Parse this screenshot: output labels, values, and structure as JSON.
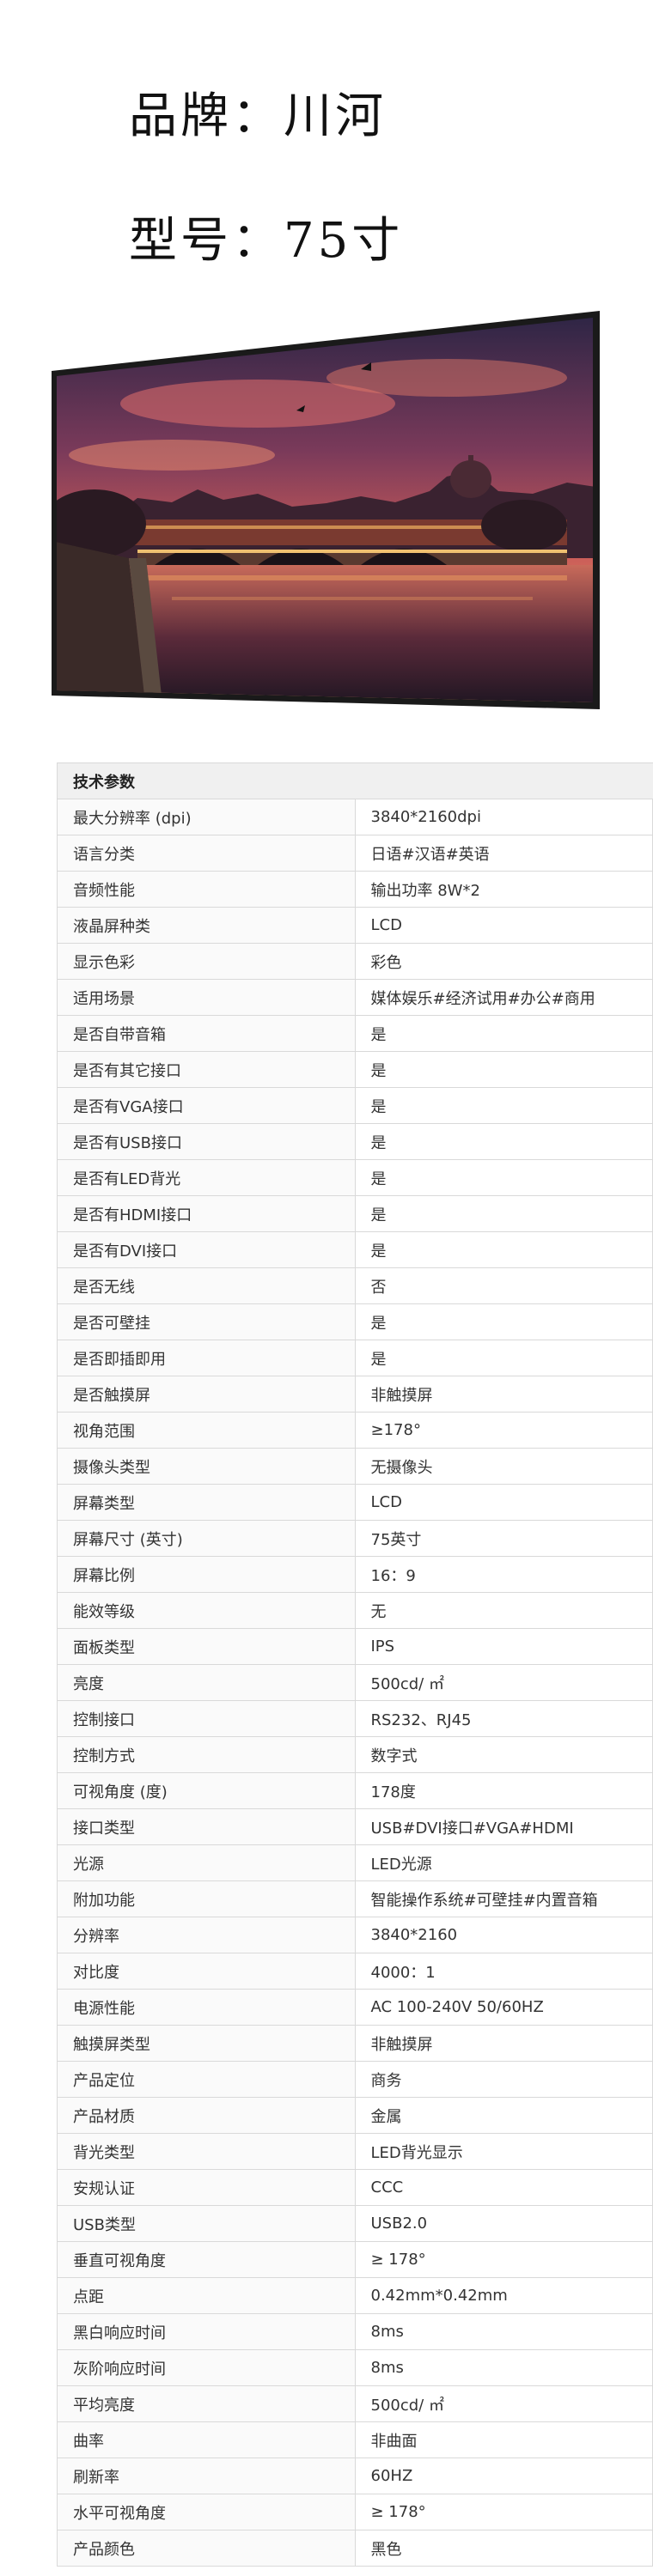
{
  "header": {
    "brand": "品牌：川河",
    "model": "型号：75寸"
  },
  "spec_table": {
    "heading": "技术参数",
    "rows": [
      {
        "k": "最大分辨率 (dpi)",
        "v": "3840*2160dpi"
      },
      {
        "k": "语言分类",
        "v": "日语#汉语#英语"
      },
      {
        "k": "音频性能",
        "v": "输出功率 8W*2"
      },
      {
        "k": "液晶屏种类",
        "v": "LCD"
      },
      {
        "k": "显示色彩",
        "v": "彩色"
      },
      {
        "k": "适用场景",
        "v": "媒体娱乐#经济试用#办公#商用"
      },
      {
        "k": "是否自带音箱",
        "v": "是"
      },
      {
        "k": "是否有其它接口",
        "v": "是"
      },
      {
        "k": "是否有VGA接口",
        "v": "是"
      },
      {
        "k": "是否有USB接口",
        "v": "是"
      },
      {
        "k": "是否有LED背光",
        "v": "是"
      },
      {
        "k": "是否有HDMI接口",
        "v": "是"
      },
      {
        "k": "是否有DVI接口",
        "v": "是"
      },
      {
        "k": "是否无线",
        "v": "否"
      },
      {
        "k": "是否可壁挂",
        "v": "是"
      },
      {
        "k": "是否即插即用",
        "v": "是"
      },
      {
        "k": "是否触摸屏",
        "v": "非触摸屏"
      },
      {
        "k": "视角范围",
        "v": "≥178°"
      },
      {
        "k": "摄像头类型",
        "v": "无摄像头"
      },
      {
        "k": "屏幕类型",
        "v": "LCD"
      },
      {
        "k": "屏幕尺寸 (英寸)",
        "v": "75英寸"
      },
      {
        "k": "屏幕比例",
        "v": "16：9"
      },
      {
        "k": "能效等级",
        "v": "无"
      },
      {
        "k": "面板类型",
        "v": "IPS"
      },
      {
        "k": "亮度",
        "v": "500cd/ ㎡"
      },
      {
        "k": "控制接口",
        "v": "RS232、RJ45"
      },
      {
        "k": "控制方式",
        "v": "数字式"
      },
      {
        "k": "可视角度 (度)",
        "v": "178度"
      },
      {
        "k": "接口类型",
        "v": "USB#DVI接口#VGA#HDMI"
      },
      {
        "k": "光源",
        "v": "LED光源"
      },
      {
        "k": "附加功能",
        "v": "智能操作系统#可壁挂#内置音箱"
      },
      {
        "k": "分辨率",
        "v": "3840*2160"
      },
      {
        "k": "对比度",
        "v": "4000：1"
      },
      {
        "k": "电源性能",
        "v": "AC 100-240V 50/60HZ"
      },
      {
        "k": "触摸屏类型",
        "v": "非触摸屏"
      },
      {
        "k": "产品定位",
        "v": "商务"
      },
      {
        "k": "产品材质",
        "v": "金属"
      },
      {
        "k": "背光类型",
        "v": "LED背光显示"
      },
      {
        "k": "安规认证",
        "v": "CCC"
      },
      {
        "k": "USB类型",
        "v": "USB2.0"
      },
      {
        "k": "垂直可视角度",
        "v": "≥ 178°"
      },
      {
        "k": "点距",
        "v": "0.42mm*0.42mm"
      },
      {
        "k": "黑白响应时间",
        "v": "8ms"
      },
      {
        "k": "灰阶响应时间",
        "v": "8ms"
      },
      {
        "k": "平均亮度",
        "v": "500cd/ ㎡"
      },
      {
        "k": "曲率",
        "v": "非曲面"
      },
      {
        "k": "刷新率",
        "v": "60HZ"
      },
      {
        "k": "水平可视角度",
        "v": "≥ 178°"
      },
      {
        "k": "产品颜色",
        "v": "黑色"
      }
    ]
  }
}
